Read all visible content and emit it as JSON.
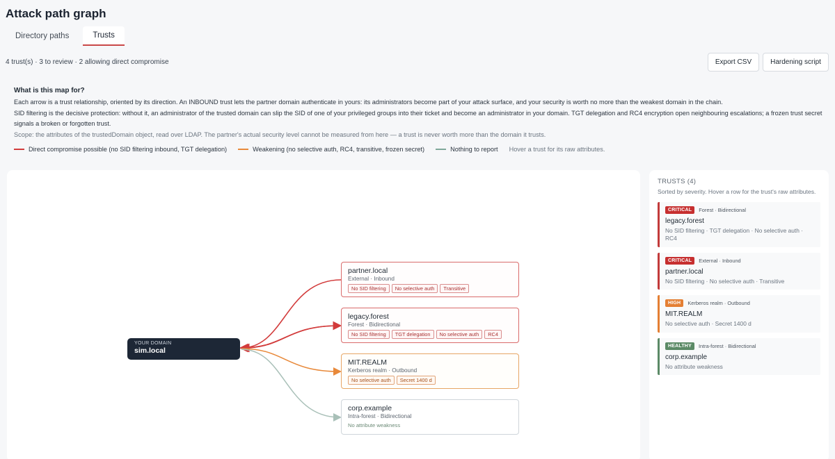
{
  "page": {
    "title": "Attack path graph"
  },
  "tabs": [
    {
      "label": "Directory paths",
      "active": false
    },
    {
      "label": "Trusts",
      "active": true
    }
  ],
  "summary": "4 trust(s) · 3 to review · 2 allowing direct compromise",
  "toolbar": {
    "export_label": "Export CSV",
    "hardening_label": "Hardening script"
  },
  "explain": {
    "heading": "What is this map for?",
    "p1": "Each arrow is a trust relationship, oriented by its direction. An INBOUND trust lets the partner domain authenticate in yours: its administrators become part of your attack surface, and your security is worth no more than the weakest domain in the chain.",
    "p2": "SID filtering is the decisive protection: without it, an administrator of the trusted domain can slip the SID of one of your privileged groups into their ticket and become an administrator in your domain. TGT delegation and RC4 encryption open neighbouring escalations; a frozen trust secret signals a broken or forgotten trust.",
    "scope": "Scope: the attributes of the trustedDomain object, read over LDAP. The partner's actual security level cannot be measured from here — a trust is never worth more than the domain it trusts."
  },
  "legend": {
    "items": [
      {
        "label": "Direct compromise possible (no SID filtering inbound, TGT delegation)",
        "color": "#d23b3b"
      },
      {
        "label": "Weakening (no selective auth, RC4, transitive, frozen secret)",
        "color": "#e8893a"
      },
      {
        "label": "Nothing to report",
        "color": "#7fa89a"
      }
    ],
    "hint": "Hover a trust for its raw attributes."
  },
  "graph": {
    "your_domain_label": "YOUR DOMAIN",
    "your_domain_name": "sim.local",
    "nodes": [
      {
        "name": "partner.local",
        "sub": "External · Inbound",
        "tags": [
          "No SID filtering",
          "No selective auth",
          "Transitive"
        ],
        "severity": "red"
      },
      {
        "name": "legacy.forest",
        "sub": "Forest · Bidirectional",
        "tags": [
          "No SID filtering",
          "TGT delegation",
          "No selective auth",
          "RC4"
        ],
        "severity": "red"
      },
      {
        "name": "MIT.REALM",
        "sub": "Kerberos realm · Outbound",
        "tags": [
          "No selective auth",
          "Secret 1400 d"
        ],
        "severity": "orange"
      },
      {
        "name": "corp.example",
        "sub": "Intra-forest · Bidirectional",
        "note": "No attribute weakness",
        "severity": "gray"
      }
    ],
    "colors": {
      "red": "#d23b3b",
      "orange": "#e8893a",
      "gray": "#a9c0b8"
    }
  },
  "panel": {
    "heading": "TRUSTS (4)",
    "desc": "Sorted by severity. Hover a row for the trust's raw attributes.",
    "cards": [
      {
        "badge": "CRITICAL",
        "badge_color": "#c62f2f",
        "meta": "Forest · Bidirectional",
        "name": "legacy.forest",
        "detail": "No SID filtering · TGT delegation · No selective auth · RC4"
      },
      {
        "badge": "CRITICAL",
        "badge_color": "#c62f2f",
        "meta": "External · Inbound",
        "name": "partner.local",
        "detail": "No SID filtering · No selective auth · Transitive"
      },
      {
        "badge": "HIGH",
        "badge_color": "#e47f33",
        "meta": "Kerberos realm · Outbound",
        "name": "MIT.REALM",
        "detail": "No selective auth · Secret 1400 d"
      },
      {
        "badge": "HEALTHY",
        "badge_color": "#5b8a66",
        "meta": "Intra-forest · Bidirectional",
        "name": "corp.example",
        "detail": "No attribute weakness"
      }
    ]
  }
}
